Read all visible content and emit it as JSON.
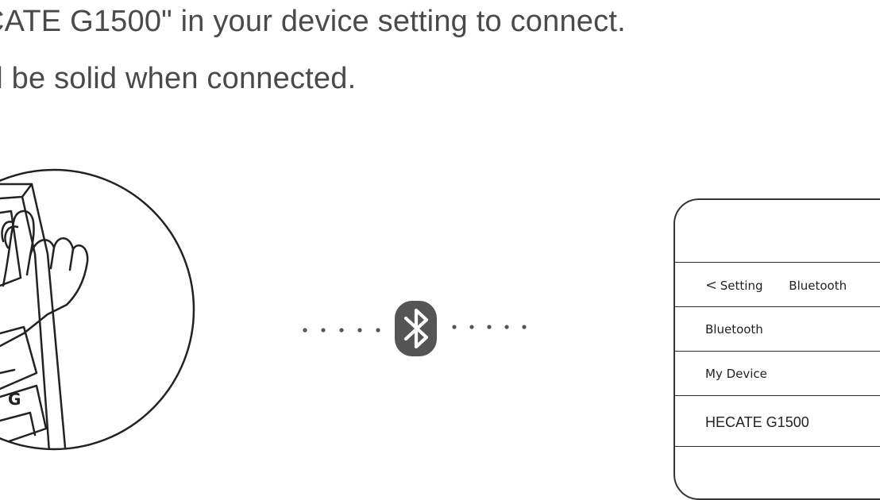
{
  "instructions": {
    "line1": "CATE G1500\" in your device setting to connect.",
    "line2": "ill be solid when connected."
  },
  "keyboard_illustration": {
    "key_labels": [
      "G"
    ]
  },
  "connection": {
    "icon": "bluetooth-icon",
    "colors": {
      "badge": "#555555",
      "dots": "#555555"
    }
  },
  "phone": {
    "nav": {
      "back_label": "Setting",
      "title": "Bluetooth"
    },
    "bluetooth_row": "Bluetooth",
    "section_header": "My Device",
    "device_name": "HECATE G1500"
  }
}
